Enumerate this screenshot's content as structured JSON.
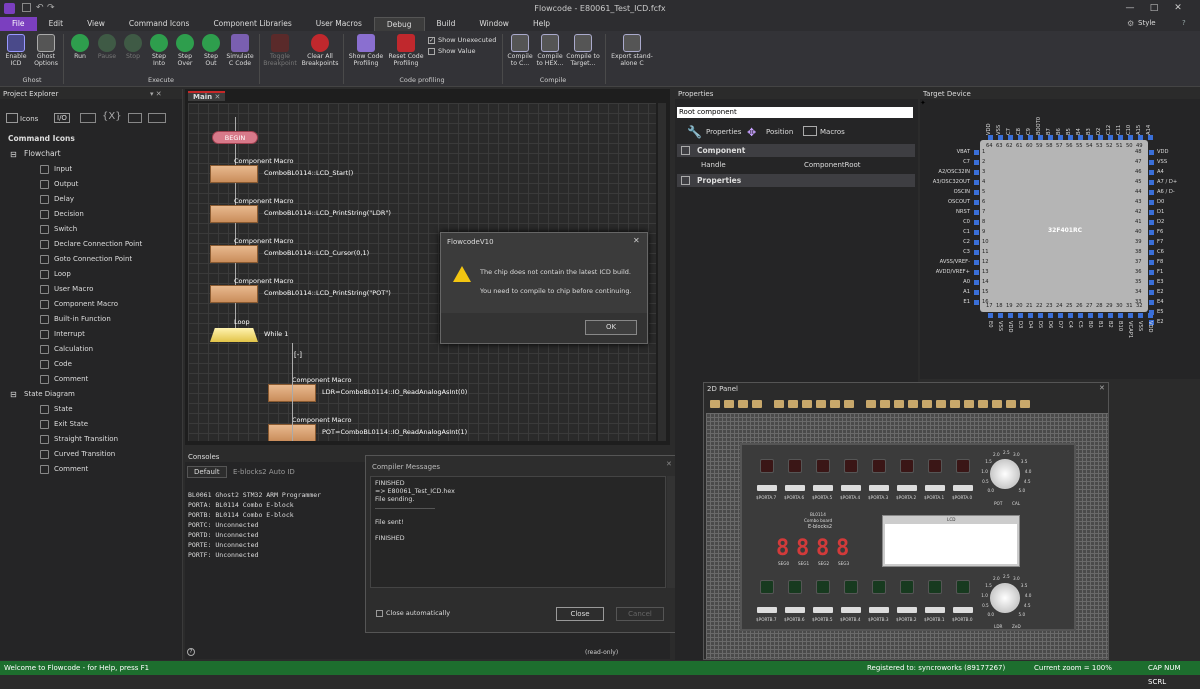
{
  "window": {
    "title": "Flowcode - E80061_Test_ICD.fcfx",
    "style_label": "Style",
    "help": "?"
  },
  "menu": [
    "File",
    "Edit",
    "View",
    "Command Icons",
    "Component Libraries",
    "User Macros",
    "Debug",
    "Build",
    "Window",
    "Help"
  ],
  "ribbon": {
    "ghost": {
      "group": "Ghost",
      "buttons": [
        "Enable ICD",
        "Ghost Options"
      ]
    },
    "execute": {
      "group": "Execute",
      "buttons": [
        "Run",
        "Pause",
        "Stop",
        "Step Into",
        "Step Over",
        "Step Out",
        "Simulate C Code"
      ]
    },
    "breakpoints": {
      "buttons": [
        "Toggle Breakpoint",
        "Clear All Breakpoints"
      ]
    },
    "profiling": {
      "group": "Code profiling",
      "buttons": [
        "Show Code Profiling",
        "Reset Code Profiling"
      ],
      "checks": [
        {
          "label": "Show Unexecuted",
          "checked": true
        },
        {
          "label": "Show Value",
          "checked": false
        }
      ]
    },
    "compile": {
      "group": "Compile",
      "buttons": [
        "Compile to C...",
        "Compile to HEX...",
        "Compile to Target..."
      ]
    },
    "export": {
      "buttons": [
        "Export stand-alone C"
      ]
    }
  },
  "project_explorer": {
    "title": "Project Explorer",
    "tabs": [
      "Icons",
      "I/O"
    ],
    "root": "Command Icons",
    "flowchart": "Flowchart",
    "flow_items": [
      "Input",
      "Output",
      "Delay",
      "Decision",
      "Switch",
      "Declare Connection Point",
      "Goto Connection Point",
      "Loop",
      "User Macro",
      "Component Macro",
      "Built-in Function",
      "Interrupt",
      "Calculation",
      "Code",
      "Comment"
    ],
    "state_diagram": "State Diagram",
    "state_items": [
      "State",
      "Exit State",
      "Straight Transition",
      "Curved Transition",
      "Comment"
    ]
  },
  "flowchart": {
    "tab": "Main",
    "begin": "BEGIN",
    "macro_label": "Component Macro",
    "blocks": [
      "ComboBL0114::LCD_Start()",
      "ComboBL0114::LCD_PrintString(\"LDR\")",
      "ComboBL0114::LCD_Cursor(0,1)",
      "ComboBL0114::LCD_PrintString(\"POT\")"
    ],
    "loop_label": "Loop",
    "loop_cond": "While 1",
    "collapse": "[-]",
    "inner_blocks": [
      "LDR=ComboBL0114::IO_ReadAnalogAsInt(0)",
      "POT=ComboBL0114::IO_ReadAnalogAsInt(1)"
    ]
  },
  "dialog": {
    "title": "FlowcodeV10",
    "line1": "The chip does not contain the latest ICD build.",
    "line2": "You need to compile to chip before continuing.",
    "ok": "OK"
  },
  "consoles": {
    "title": "Consoles",
    "tabs": [
      "Default",
      "E-blocks2 Auto ID"
    ],
    "lines": [
      "BL0061 Ghost2 STM32 ARM Programmer",
      "PORTA: BL0114 Combo E-block",
      "PORTB: BL0114 Combo E-block",
      "PORTC: Unconnected",
      "PORTD: Unconnected",
      "PORTE: Unconnected",
      "PORTF: Unconnected"
    ],
    "readonly": "(read-only)"
  },
  "compiler": {
    "title": "Compiler Messages",
    "lines": [
      "FINISHED",
      "=> E80061_Test_ICD.hex",
      "File sending.",
      "..............................",
      "",
      "File sent!",
      "",
      "FINISHED"
    ],
    "auto_close": "Close automatically",
    "close": "Close",
    "cancel": "Cancel"
  },
  "properties": {
    "title": "Properties",
    "selected": "Root component",
    "tabs": [
      "Properties",
      "Position",
      "Macros"
    ],
    "component_section": "Component",
    "handle_label": "Handle",
    "handle_value": "ComponentRoot",
    "properties_section": "Properties"
  },
  "target": {
    "title": "Target Device",
    "chip": "32F401RC",
    "left_pins": [
      "VBAT",
      "C7",
      "A2/OSC32IN",
      "A3/OSC32OUT",
      "OSCIN",
      "OSCOUT",
      "NRST",
      "C0",
      "C1",
      "C2",
      "C3",
      "AVSS/VREF-",
      "AVDD/VREF+",
      "A0",
      "A1",
      "E1"
    ],
    "right_pins": [
      "VDD",
      "VSS",
      "A4",
      "A7 / D+",
      "A6 / D-",
      "D0",
      "D1",
      "D2",
      "F6",
      "F7",
      "C6",
      "F8",
      "F1",
      "E3",
      "E2",
      "E4",
      "E5",
      "E2"
    ],
    "top_pins": [
      "VDD",
      "VSS",
      "C7",
      "C8",
      "C9",
      "BOOT0",
      "B7",
      "B6",
      "B5",
      "B4",
      "B3",
      "D2",
      "C12",
      "C11",
      "C10",
      "A15",
      "A14"
    ],
    "bottom_pins": [
      "E0",
      "VSS",
      "VDD",
      "D3",
      "D4",
      "D5",
      "D6",
      "D7",
      "C4",
      "C5",
      "B0",
      "B1",
      "B2",
      "B10",
      "VCAP1",
      "VSS",
      "VDD"
    ],
    "top_nums": [
      "64",
      "63",
      "62",
      "61",
      "60",
      "59",
      "58",
      "57",
      "56",
      "55",
      "54",
      "53",
      "52",
      "51",
      "50",
      "49"
    ],
    "bottom_nums": [
      "17",
      "18",
      "19",
      "20",
      "21",
      "22",
      "23",
      "24",
      "25",
      "26",
      "27",
      "28",
      "29",
      "30",
      "31",
      "32"
    ],
    "left_nums": [
      "1",
      "2",
      "3",
      "4",
      "5",
      "6",
      "7",
      "8",
      "9",
      "10",
      "11",
      "12",
      "13",
      "14",
      "15",
      "16"
    ],
    "right_nums": [
      "48",
      "47",
      "46",
      "45",
      "44",
      "43",
      "42",
      "41",
      "40",
      "39",
      "38",
      "37",
      "36",
      "35",
      "34",
      "33"
    ]
  },
  "panel2d": {
    "title": "2D Panel",
    "board_name": "BL0114",
    "board_sub": "Combo board",
    "board_brand": "E-blocks2",
    "porta_labels": [
      "$PORTA.7",
      "$PORTA.6",
      "$PORTA.5",
      "$PORTA.4",
      "$PORTA.3",
      "$PORTA.2",
      "$PORTA.1",
      "$PORTA.0"
    ],
    "portb_labels": [
      "$PORTB.7",
      "$PORTB.6",
      "$PORTB.5",
      "$PORTB.4",
      "$PORTB.3",
      "$PORTB.2",
      "$PORTB.1",
      "$PORTB.0"
    ],
    "seg_digits": [
      "8",
      "8",
      "8",
      "8"
    ],
    "seg_labels": [
      "SEG0",
      "SEG1",
      "SEG2",
      "SEG3"
    ],
    "knob1": [
      "POT",
      "CAL"
    ],
    "knob2": [
      "LDR",
      "ZeD"
    ],
    "lcd_label": "LCD",
    "knob_scale": [
      "0.0",
      "0.5",
      "1.0",
      "1.5",
      "2.0",
      "2.5",
      "3.0",
      "3.5",
      "4.0",
      "4.5",
      "5.0"
    ]
  },
  "status": {
    "left": "Welcome to Flowcode - for Help, press F1",
    "registered": "Registered to: syncroworks (89177267)",
    "zoom": "Current zoom = 100%",
    "keys": "CAP NUM SCRL"
  }
}
